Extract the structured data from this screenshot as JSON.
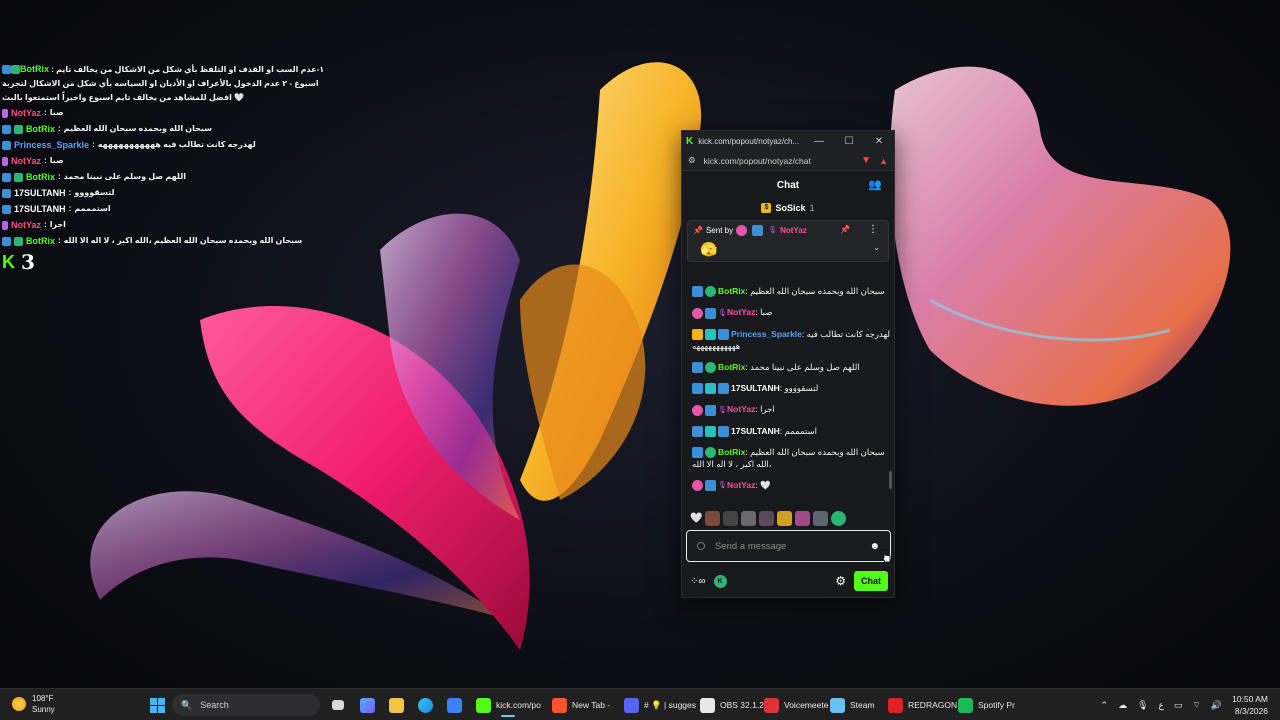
{
  "overlay_chat": {
    "lines": [
      {
        "user": "BotRix",
        "color": "#53fc18",
        "text": "١-عدم السب او القذف او التلفظ بأي شكل من الاشكال من يخالف تايم اسبوع - ٢ عدم الدخول بالأعراف او الأديان او السياسه بأي شكل من الاشكال لتجربة افضل للمشاهد من يخالف تايم اسبوع واخيراً استمتعوا بالبث 🤍"
      },
      {
        "user": "NotYaz",
        "color": "#ff4f7b",
        "text": "صبا"
      },
      {
        "user": "BotRix",
        "color": "#53fc18",
        "text": "سبحان الله وبحمده سبحان الله العظيم"
      },
      {
        "user": "Princess_Sparkle",
        "color": "#5aa0ff",
        "text": "لهدرجه كانت تطالب فيه هههههههههههه"
      },
      {
        "user": "NotYaz",
        "color": "#ff4f7b",
        "text": "صبا"
      },
      {
        "user": "BotRix",
        "color": "#53fc18",
        "text": "اللهم صل وسلم على نبينا محمد"
      },
      {
        "user": "17SULTANH",
        "color": "#ffffff",
        "text": "لتسقوووو"
      },
      {
        "user": "17SULTANH",
        "color": "#ffffff",
        "text": "استمممم"
      },
      {
        "user": "NotYaz",
        "color": "#ff4f7b",
        "text": "اجرا"
      },
      {
        "user": "BotRix",
        "color": "#53fc18",
        "text": "سبحان الله وبحمده سبحان الله العظيم ،الله اكبر ، لا اله الا الله"
      }
    ],
    "viewer_count": "3"
  },
  "popout": {
    "window_title": "kick.com/popout/notyaz/ch...",
    "url": "kick.com/popout/notyaz/chat",
    "chat_title": "Chat",
    "top_gifter": {
      "name": "SoSick",
      "count": "1"
    },
    "pinned": {
      "sent_by_label": "Sent by",
      "user": "NotYaz",
      "emote": "🫣"
    },
    "messages": [
      {
        "user": "BotRix",
        "color": "#53fc18",
        "text": "سبحان الله وبحمده سبحان الله العظيم"
      },
      {
        "user": "NotYaz",
        "color": "#ff4fa3",
        "text": "صبا"
      },
      {
        "user": "Princess_Sparkle",
        "color": "#5aa0ff",
        "text": "لهدرجه كانت تطالب فيه هههههههههههه"
      },
      {
        "user": "BotRix",
        "color": "#53fc18",
        "text": "اللهم صل وسلم على نبينا محمد"
      },
      {
        "user": "17SULTANH",
        "color": "#ffffff",
        "text": "لتسقوووو"
      },
      {
        "user": "NotYaz",
        "color": "#ff4fa3",
        "text": "اجرا"
      },
      {
        "user": "17SULTANH",
        "color": "#ffffff",
        "text": "استمممم"
      },
      {
        "user": "BotRix",
        "color": "#53fc18",
        "text": "سبحان الله وبحمده سبحان الله العظيم ،الله اكبر ، لا اله الا الله"
      },
      {
        "user": "NotYaz",
        "color": "#ff4fa3",
        "text": "🤍"
      }
    ],
    "input_placeholder": "Send a message",
    "chat_button": "Chat"
  },
  "taskbar": {
    "weather_temp": "108°F",
    "weather_cond": "Sunny",
    "search_label": "Search",
    "apps": [
      {
        "label": "kick.com/po",
        "color": "#53fc18"
      },
      {
        "label": "New Tab -",
        "color": "#fb542b"
      },
      {
        "label": "# 💡 | sugges",
        "color": "#5865f2"
      },
      {
        "label": "OBS 32.1.2 -",
        "color": "#e8e8e8"
      },
      {
        "label": "Voicemeete",
        "color": "#d33"
      },
      {
        "label": "Steam",
        "color": "#66c0f4"
      },
      {
        "label": "REDRAGON",
        "color": "#d22"
      },
      {
        "label": "Spotify Pr",
        "color": "#1db954"
      }
    ],
    "language": "ع",
    "time": "10:50 AM",
    "date": "8/3/2026"
  }
}
